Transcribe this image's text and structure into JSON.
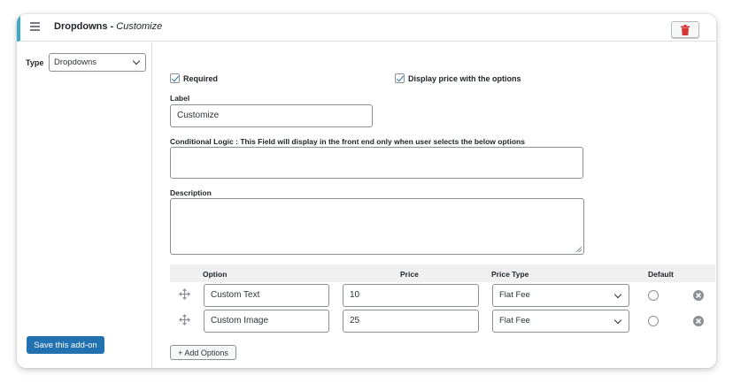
{
  "header": {
    "title": "Dropdowns",
    "separator": " - ",
    "subtitle": "Customize"
  },
  "left": {
    "type_label": "Type",
    "type_value": "Dropdowns",
    "save_label": "Save this add-on"
  },
  "form": {
    "required_label": "Required",
    "required_checked": true,
    "display_price_label": "Display price with the options",
    "display_price_checked": true,
    "label_title": "Label",
    "label_value": "Customize",
    "conditional_title": "Conditional Logic : This Field will display in the front end only when user selects the below options",
    "conditional_value": "",
    "description_title": "Description",
    "description_value": ""
  },
  "options_table": {
    "headers": {
      "option": "Option",
      "price": "Price",
      "price_type": "Price Type",
      "default": "Default"
    },
    "rows": [
      {
        "option": "Custom Text",
        "price": "10",
        "price_type": "Flat Fee",
        "default": false
      },
      {
        "option": "Custom Image",
        "price": "25",
        "price_type": "Flat Fee",
        "default": false
      }
    ],
    "add_label": "+ Add Options"
  },
  "colors": {
    "accent_bar": "#3da9c7",
    "primary_button": "#2271b1",
    "delete_icon": "#d63638"
  },
  "icons": {
    "menu": "hamburger-icon",
    "delete": "trash-icon",
    "move": "move-icon",
    "remove": "remove-circle-icon",
    "check": "checkmark-icon"
  }
}
